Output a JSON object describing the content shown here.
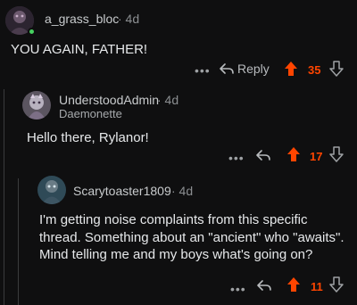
{
  "comments": [
    {
      "username": "a_grass_bloc",
      "time": "· 4d",
      "text": "YOU AGAIN, FATHER!",
      "actions": {
        "more": "•••",
        "reply": "Reply",
        "score": "35"
      }
    },
    {
      "username": "UnderstoodAdmin",
      "time": "· 4d",
      "flair": "Daemonette",
      "text": "Hello there, Rylanor!",
      "actions": {
        "more": "•••",
        "score": "17"
      }
    },
    {
      "username": "Scarytoaster1809",
      "time": "· 4d",
      "text": "I'm getting noise complaints from this specific thread. Something about an \"ancient\" who \"awaits\". Mind telling me and my boys what's going on?",
      "actions": {
        "more": "•••",
        "score": "11"
      }
    }
  ],
  "colors": {
    "background": "#0f0f10",
    "upvote": "#ff4500",
    "online": "#46d160"
  },
  "icons": [
    "reply-arrow-icon",
    "upvote-icon",
    "downvote-icon",
    "more-icon"
  ]
}
